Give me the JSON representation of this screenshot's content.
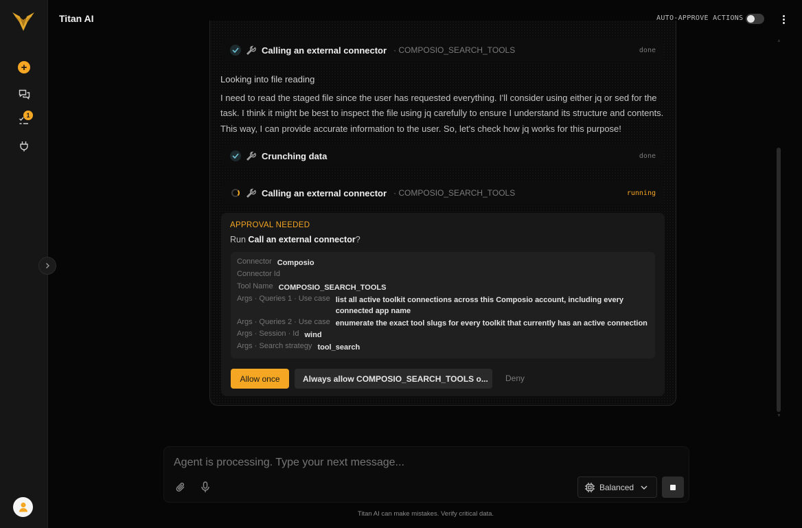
{
  "app": {
    "title": "Titan AI"
  },
  "sidebar": {
    "items": [
      {
        "icon": "plus-circle-icon",
        "label": "New"
      },
      {
        "icon": "chats-icon",
        "label": "Chats"
      },
      {
        "icon": "tasks-icon",
        "label": "Tasks",
        "badge": "1"
      },
      {
        "icon": "plug-icon",
        "label": "Connectors"
      }
    ]
  },
  "header": {
    "auto_approve_label": "AUTO-APPROVE ACTIONS",
    "auto_approve_on": false
  },
  "steps": [
    {
      "label": "Calling an external connector",
      "sub": "· COMPOSIO_SEARCH_TOOLS",
      "status": "done"
    },
    {
      "label": "Crunching data",
      "sub": "",
      "status": "done"
    },
    {
      "label": "Calling an external connector",
      "sub": "· COMPOSIO_SEARCH_TOOLS",
      "status": "running"
    }
  ],
  "thought": {
    "title": "Looking into file reading",
    "body": "I need to read the staged file since the user has requested everything. I'll consider using either jq or sed for the task. I think it might be best to inspect the file using jq carefully to ensure I understand its structure and contents. This way, I can provide accurate information to the user. So, let's check how jq works for this purpose!"
  },
  "approval": {
    "label": "APPROVAL NEEDED",
    "question_prefix": "Run",
    "question_action": "Call an external connector",
    "question_suffix": "?",
    "params": [
      {
        "key": "Connector",
        "value": "Composio"
      },
      {
        "key": "Connector Id",
        "value": ""
      },
      {
        "key": "Tool Name",
        "value": "COMPOSIO_SEARCH_TOOLS"
      },
      {
        "key": "Args · Queries 1 · Use case",
        "value": "list all active toolkit connections across this Composio account, including every connected app name"
      },
      {
        "key": "Args · Queries 2 · Use case",
        "value": "enumerate the exact tool slugs for every toolkit that currently has an active connection"
      },
      {
        "key": "Args · Session · Id",
        "value": "wind"
      },
      {
        "key": "Args · Search strategy",
        "value": "tool_search"
      }
    ],
    "allow_once": "Allow once",
    "always_allow": "Always allow COMPOSIO_SEARCH_TOOLS o...",
    "deny": "Deny"
  },
  "composer": {
    "placeholder": "Agent is processing. Type your next message...",
    "mode": "Balanced",
    "disclaimer": "Titan AI can make mistakes. Verify critical data."
  },
  "colors": {
    "accent": "#f5a623",
    "background": "#060606",
    "sidebar": "#161616"
  }
}
